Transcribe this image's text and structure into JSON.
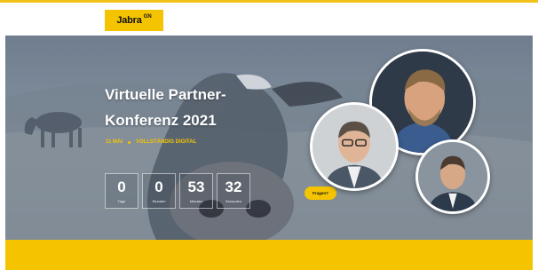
{
  "header": {
    "logo_text": "Jabra",
    "logo_sup": "GN"
  },
  "hero": {
    "title_line1": "Virtuelle Partner-",
    "title_line2": "Konferenz 2021",
    "date": "11 MAI",
    "format": "VOLLSTÄNDIG DIGITAL",
    "countdown": [
      {
        "value": "0",
        "label": "Tage"
      },
      {
        "value": "0",
        "label": "Stunden"
      },
      {
        "value": "53",
        "label": "Minuten"
      },
      {
        "value": "32",
        "label": "Sekunden"
      }
    ],
    "cta_label": "Fragen?"
  },
  "colors": {
    "brand_yellow": "#f5c400",
    "hero_overlay": "#7e8b9b"
  },
  "icons": [
    "jabra-logo",
    "speaker-avatar"
  ]
}
